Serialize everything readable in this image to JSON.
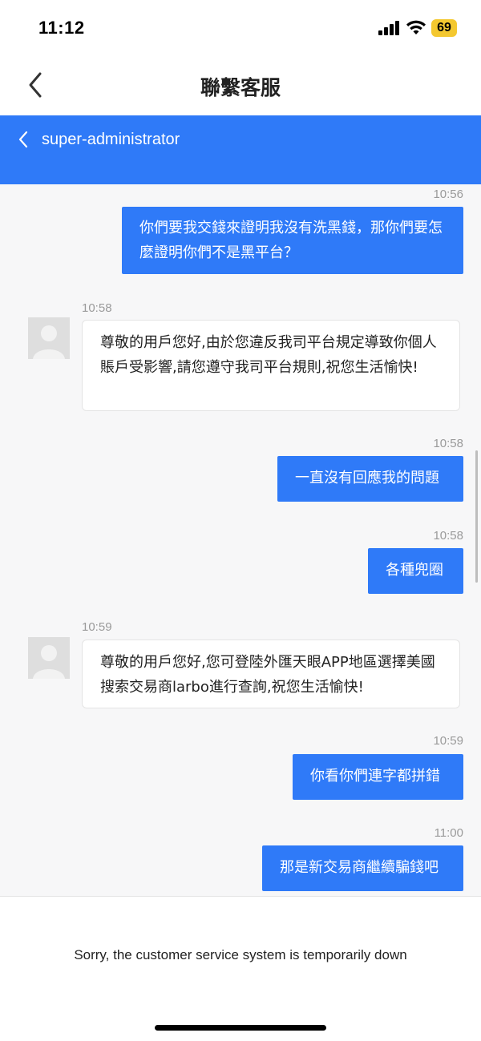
{
  "status_bar": {
    "time": "11:12",
    "battery": "69"
  },
  "nav": {
    "title": "聯繫客服"
  },
  "chat_header": {
    "title": "super-administrator"
  },
  "messages": [
    {
      "side": "out",
      "time": "10:56",
      "text": "你們要我交錢來證明我沒有洗黑錢，那你們要怎麼證明你們不是黑平台？"
    },
    {
      "side": "in",
      "time": "10:58",
      "text": "尊敬的用戶您好,由於您違反我司平台規定導致你個人賬戶受影響,請您遵守我司平台規則,祝您生活愉快!"
    },
    {
      "side": "out",
      "time": "10:58",
      "text": "一直沒有回應我的問題"
    },
    {
      "side": "out",
      "time": "10:58",
      "text": "各種兜圈"
    },
    {
      "side": "in",
      "time": "10:59",
      "text": "尊敬的用戶您好,您可登陸外匯天眼APP地區選擇美國搜索交易商larbo進行查詢,祝您生活愉快!"
    },
    {
      "side": "out",
      "time": "10:59",
      "text": "你看你們連字都拼錯"
    },
    {
      "side": "out",
      "time": "11:00",
      "text": "那是新交易商繼續騙錢吧"
    }
  ],
  "footer": {
    "message": "Sorry, the customer service system is temporarily down"
  }
}
